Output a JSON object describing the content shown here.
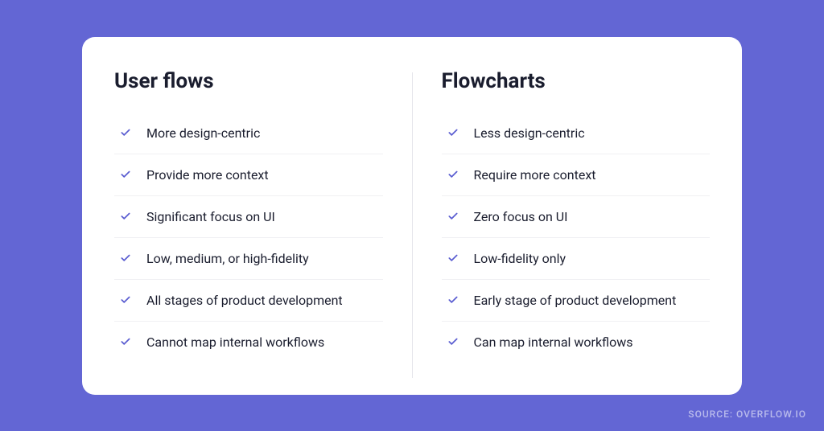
{
  "colors": {
    "background": "#6366d4",
    "card_bg": "#ffffff",
    "heading": "#1a1d2e",
    "body_text": "#1a1d2e",
    "check": "#5b5ed1",
    "divider": "#e5e5ea"
  },
  "left": {
    "title": "User flows",
    "items": [
      "More design-centric",
      "Provide more context",
      "Significant focus on UI",
      "Low, medium, or high-fidelity",
      "All stages of product development",
      "Cannot map internal workflows"
    ]
  },
  "right": {
    "title": "Flowcharts",
    "items": [
      "Less design-centric",
      "Require more context",
      "Zero focus on UI",
      "Low-fidelity only",
      "Early stage of product development",
      "Can map internal workflows"
    ]
  },
  "source": "SOURCE: OVERFLOW.IO"
}
